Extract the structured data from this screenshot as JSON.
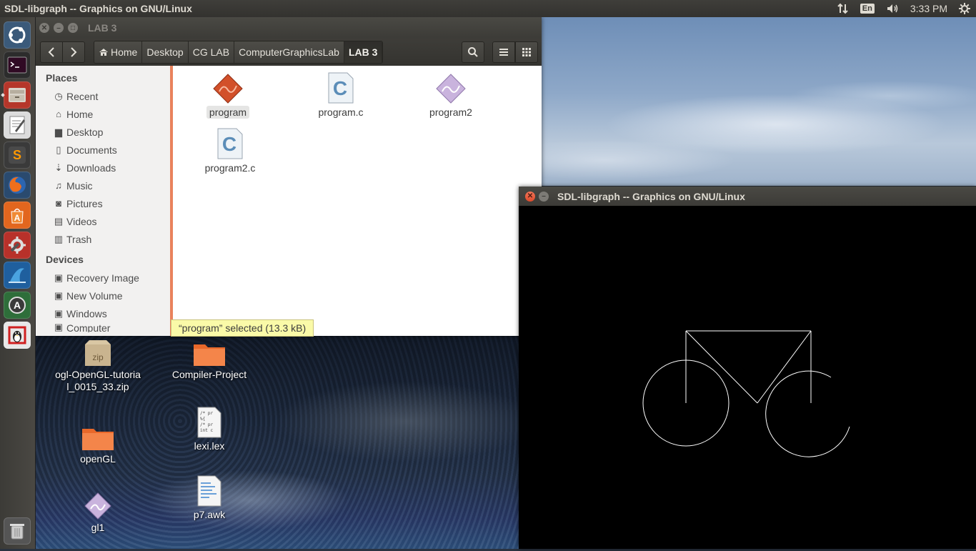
{
  "top_panel": {
    "title": "SDL-libgraph -- Graphics on GNU/Linux",
    "keyboard_indicator": "En",
    "clock": "3:33 PM",
    "icons": [
      "network-updown-icon",
      "keyboard-layout-icon",
      "volume-icon",
      "settings-gear-icon"
    ]
  },
  "launcher": {
    "items": [
      "dash-home",
      "terminal",
      "files",
      "text-editor",
      "sublime-text",
      "firefox",
      "ubuntu-software-center",
      "system-settings",
      "wireshark",
      "software-updater",
      "gnome-tux-app",
      "trash"
    ]
  },
  "file_manager": {
    "window_title": "LAB 3",
    "breadcrumbs": [
      "Home",
      "Desktop",
      "CG LAB",
      "ComputerGraphicsLab",
      "LAB 3"
    ],
    "sidebar": {
      "places_heading": "Places",
      "places": [
        "Recent",
        "Home",
        "Desktop",
        "Documents",
        "Downloads",
        "Music",
        "Pictures",
        "Videos",
        "Trash"
      ],
      "devices_heading": "Devices",
      "devices": [
        "Recovery Image",
        "New Volume",
        "Windows",
        "Computer"
      ]
    },
    "files": [
      {
        "name": "program",
        "type": "executable",
        "selected": true
      },
      {
        "name": "program.c",
        "type": "c-source"
      },
      {
        "name": "program2",
        "type": "executable-purple"
      },
      {
        "name": "program2.c",
        "type": "c-source"
      }
    ],
    "status": "“program” selected  (13.3 kB)"
  },
  "desktop_icons": [
    {
      "name": "ogl-OpenGL-tutorial_0015_33.zip",
      "type": "zip"
    },
    {
      "name": "Compiler-Project",
      "type": "folder"
    },
    {
      "name": "openGL",
      "type": "folder"
    },
    {
      "name": "lexi.lex",
      "type": "text"
    },
    {
      "name": "gl1",
      "type": "executable-purple"
    },
    {
      "name": "p7.awk",
      "type": "script"
    }
  ],
  "sdl_window": {
    "title": "SDL-libgraph -- Graphics on GNU/Linux",
    "drawing": "bicycle",
    "canvas_background": "#000000",
    "stroke_color": "#ffffff"
  },
  "colors": {
    "accent_orange": "#e9825c",
    "panel_dark": "#3c3b37",
    "status_yellow": "#fafaa8"
  }
}
